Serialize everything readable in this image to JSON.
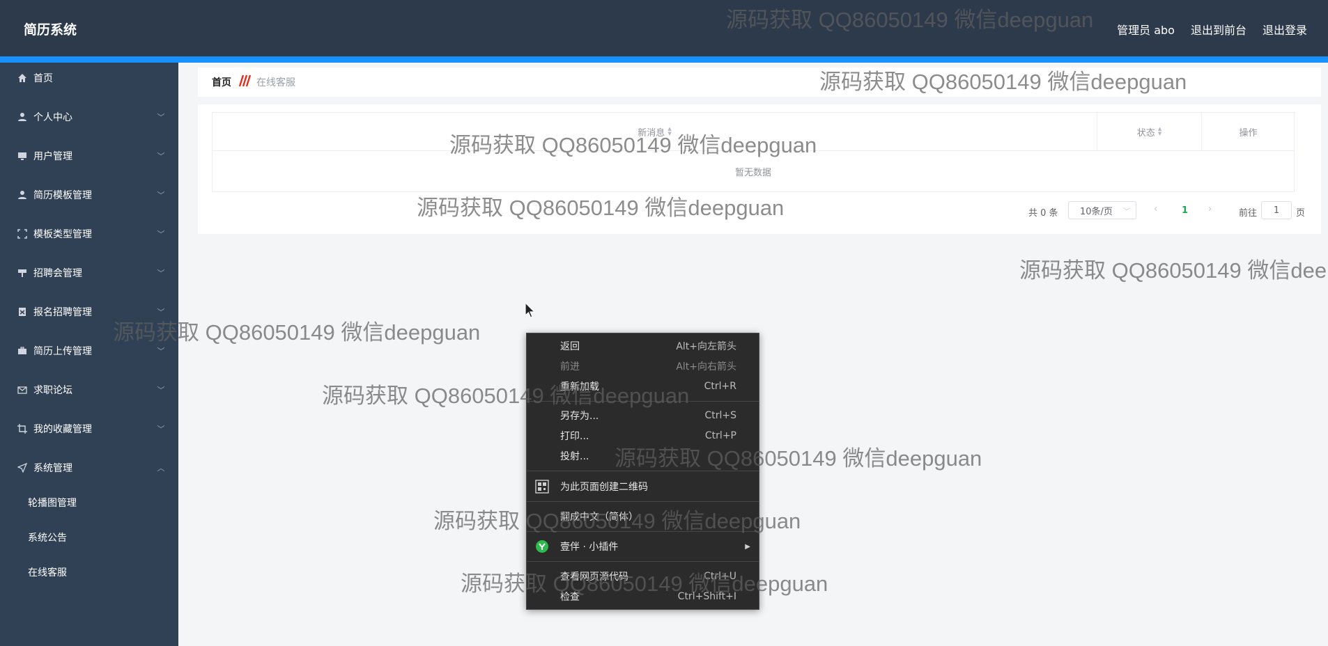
{
  "header": {
    "brand": "简历系统",
    "admin": "管理员 abo",
    "to_front": "退出到前台",
    "logout": "退出登录",
    "accent": "#1890ff"
  },
  "sidebar": {
    "items": [
      {
        "label": "首页",
        "icon": "home-icon",
        "has_arrow": false
      },
      {
        "label": "个人中心",
        "icon": "user-icon",
        "has_arrow": true
      },
      {
        "label": "用户管理",
        "icon": "monitor-icon",
        "has_arrow": true
      },
      {
        "label": "简历模板管理",
        "icon": "user-icon",
        "has_arrow": true
      },
      {
        "label": "模板类型管理",
        "icon": "fullscreen-icon",
        "has_arrow": true
      },
      {
        "label": "招聘会管理",
        "icon": "podium-icon",
        "has_arrow": true
      },
      {
        "label": "报名招聘管理",
        "icon": "badge-icon",
        "has_arrow": true
      },
      {
        "label": "简历上传管理",
        "icon": "briefcase-icon",
        "has_arrow": true
      },
      {
        "label": "求职论坛",
        "icon": "mail-icon",
        "has_arrow": true
      },
      {
        "label": "我的收藏管理",
        "icon": "crop-icon",
        "has_arrow": true
      },
      {
        "label": "系统管理",
        "icon": "send-icon",
        "has_arrow": true,
        "expanded": true
      }
    ],
    "sub_items": [
      {
        "label": "轮播图管理"
      },
      {
        "label": "系统公告"
      },
      {
        "label": "在线客服"
      }
    ]
  },
  "breadcrumb": {
    "home": "首页",
    "current": "在线客服"
  },
  "table": {
    "columns": [
      {
        "label": "新消息",
        "sortable": true
      },
      {
        "label": "状态",
        "sortable": true
      },
      {
        "label": "操作",
        "sortable": false
      }
    ],
    "empty_text": "暂无数据"
  },
  "pagination": {
    "total": "共 0 条",
    "page_size": "10条/页",
    "current_page": "1",
    "goto_label": "前往",
    "goto_value": "1",
    "page_suffix": "页"
  },
  "context_menu": {
    "items": [
      {
        "label": "返回",
        "shortcut": "Alt+向左箭头",
        "disabled": false
      },
      {
        "label": "前进",
        "shortcut": "Alt+向右箭头",
        "disabled": true
      },
      {
        "label": "重新加载",
        "shortcut": "Ctrl+R",
        "disabled": false
      },
      {
        "label": "另存为...",
        "shortcut": "Ctrl+S",
        "disabled": false
      },
      {
        "label": "打印...",
        "shortcut": "Ctrl+P",
        "disabled": false
      },
      {
        "label": "投射...",
        "shortcut": "",
        "disabled": false
      },
      {
        "label": "为此页面创建二维码",
        "shortcut": "",
        "icon": "qr-code-icon"
      },
      {
        "label": "翻成中文（简体）",
        "shortcut": ""
      },
      {
        "label": "壹伴 · 小插件",
        "shortcut": "",
        "icon": "yiban-icon",
        "submenu": true
      },
      {
        "label": "查看网页源代码",
        "shortcut": "Ctrl+U"
      },
      {
        "label": "检查",
        "shortcut": "Ctrl+Shift+I"
      }
    ]
  },
  "watermark": {
    "text": "源码获取 QQ86050149 微信deepguan"
  }
}
